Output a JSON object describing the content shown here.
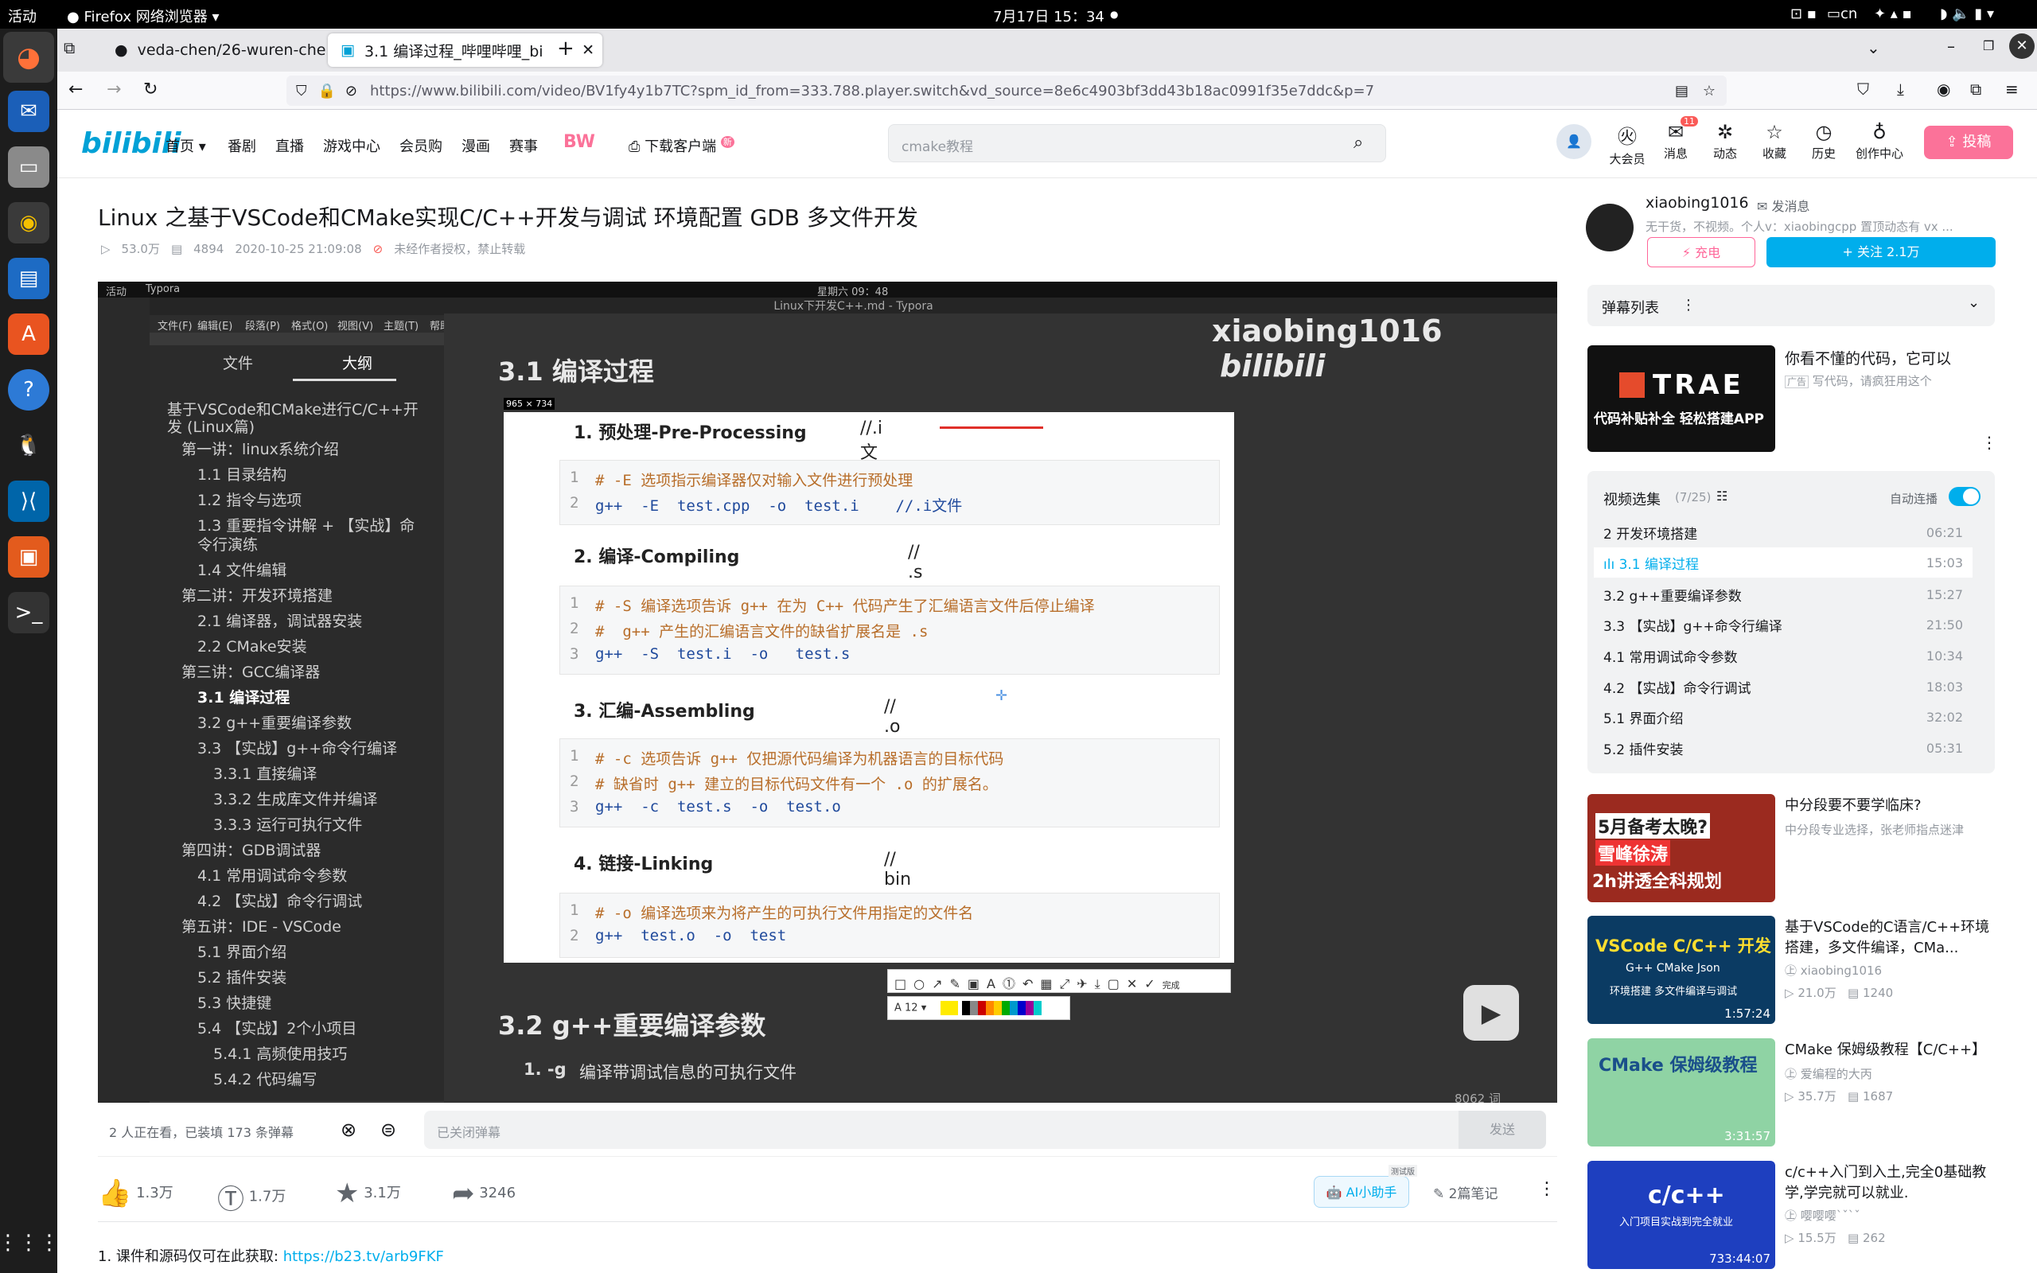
{
  "os": {
    "activities": "活动",
    "browser_label": "Firefox 网络浏览器",
    "clock": "7月17日 15：34",
    "lang": "cn"
  },
  "tabs": [
    {
      "label": "veda-chen/26-wuren-che"
    },
    {
      "label": "3.1 编译过程_哔哩哔哩_bi"
    }
  ],
  "url": "https://www.bilibili.com/video/BV1fy4y1b7TC?spm_id_from=333.788.player.switch&vd_source=8e6c4903bf3dd43b18ac0991f35e7ddc&p=7",
  "header": {
    "nav": [
      "首页",
      "番剧",
      "直播",
      "游戏中心",
      "会员购",
      "漫画",
      "赛事",
      "下载客户端"
    ],
    "bw_logo": "BW",
    "download_badge": "新",
    "search_placeholder": "cmake教程",
    "icons": [
      {
        "label": "大会员",
        "glyph": "㊋"
      },
      {
        "label": "消息",
        "glyph": "✉"
      },
      {
        "label": "动态",
        "glyph": "✲"
      },
      {
        "label": "收藏",
        "glyph": "☆"
      },
      {
        "label": "历史",
        "glyph": "◷"
      },
      {
        "label": "创作中心",
        "glyph": "💡"
      }
    ],
    "message_badge": "11",
    "upload": "投稿"
  },
  "video": {
    "title": "Linux 之基于VSCode和CMake实现C/C++开发与调试 环境配置 GDB 多文件开发",
    "views": "53.0万",
    "danmaku": "4894",
    "date": "2020-10-25 21:09:08",
    "copyright": "未经作者授权，禁止转载"
  },
  "player": {
    "watermark": "xiaobing1016",
    "watermark_logo": "bilibili",
    "sys_time": "星期六 09：48",
    "doc_title": "Linux下开发C++.md - Typora",
    "app_name": "Typora",
    "menu": [
      "文件(F)",
      "编辑(E)",
      "段落(P)",
      "格式(O)",
      "视图(V)",
      "主题(T)",
      "帮助(H)"
    ],
    "side_tabs": [
      "文件",
      "大纲"
    ],
    "outline": [
      "基于VSCode和CMake进行C/C++开",
      "发 (Linux篇)",
      "第一讲：linux系统介绍",
      "1.1 目录结构",
      "1.2 指令与选项",
      "1.3 重要指令讲解 + 【实战】命",
      "令行演练",
      "1.4 文件编辑",
      "第二讲：开发环境搭建",
      "2.1 编译器，调试器安装",
      "2.2 CMake安装",
      "第三讲：GCC编译器",
      "3.1 编译过程",
      "3.2 g++重要编译参数",
      "3.3 【实战】g++命令行编译",
      "3.3.1 直接编译",
      "3.3.2 生成库文件并编译",
      "3.3.3 运行可执行文件",
      "第四讲：GDB调试器",
      "4.1 常用调试命令参数",
      "4.2 【实战】命令行调试",
      "第五讲：IDE - VSCode",
      "5.1 界面介绍",
      "5.2 插件安装",
      "5.3 快捷键",
      "5.4 【实战】2个小项目",
      "5.4.1 高频使用技巧",
      "5.4.2 代码编写"
    ],
    "h1": "3.1 编译过程",
    "h1_next": "3.2 g++重要编译参数",
    "next_item": "1. -g",
    "next_item_desc": "编译带调试信息的可执行文件",
    "word_count": "8062 词",
    "shot_size": "965 × 734",
    "sections": [
      {
        "title": "1. 预处理-Pre-Processing",
        "note": "//.i文件",
        "lines": [
          "# -E 选项指示编译器仅对输入文件进行预处理",
          "g++  -E  test.cpp  -o  test.i    //.i文件"
        ]
      },
      {
        "title": "2. 编译-Compiling",
        "note": "// .s文件",
        "lines": [
          "# -S 编译选项告诉 g++ 在为 C++ 代码产生了汇编语言文件后停止编译",
          "#  g++ 产生的汇编语言文件的缺省扩展名是 .s",
          "g++  -S  test.i  -o   test.s"
        ]
      },
      {
        "title": "3. 汇编-Assembling",
        "note": "// .o文件",
        "lines": [
          "# -c 选项告诉 g++ 仅把源代码编译为机器语言的目标代码",
          "# 缺省时 g++ 建立的目标代码文件有一个 .o 的扩展名。",
          "g++  -c  test.s  -o  test.o"
        ]
      },
      {
        "title": "4. 链接-Linking",
        "note": "// bin文件",
        "lines": [
          "# -o 编译选项来为将产生的可执行文件用指定的文件名",
          "g++  test.o  -o  test"
        ]
      }
    ],
    "toolbar_done": "完成",
    "font_size": "12"
  },
  "danmu_bar": {
    "status": "2 人正在看，已装填 173 条弹幕",
    "input_placeholder": "已关闭弹幕",
    "send": "发送"
  },
  "actions": {
    "like": "1.3万",
    "coin": "1.7万",
    "fav": "3.1万",
    "share": "3246",
    "ai": "AI小助手",
    "ai_tag": "测试版",
    "notes": "2篇笔记"
  },
  "description": {
    "prefix": "1. 课件和源码仅可在此获取: ",
    "link": "https://b23.tv/arb9FKF"
  },
  "uploader": {
    "name": "xiaobing1016",
    "send_msg": "发消息",
    "bio": "无干货，不视频。个人v：xiaobingcpp 置顶动态有 vx ...",
    "charge": "充电",
    "follow": "关注 2.1万"
  },
  "danmaku_list": {
    "label": "弹幕列表"
  },
  "ad": {
    "brand": "TRAE",
    "caption": "代码补贴补全 轻松搭建APP",
    "title": "你看不懂的代码，它可以",
    "badge": "广告",
    "sub": "写代码，请疯狂用这个"
  },
  "playlist": {
    "title": "视频选集",
    "count": "(7/25)",
    "autoplay": "自动连播",
    "items": [
      {
        "title": "2 开发环境搭建",
        "dur": "06:21"
      },
      {
        "title": "3.1 编译过程",
        "dur": "15:03"
      },
      {
        "title": "3.2 g++重要编译参数",
        "dur": "15:27"
      },
      {
        "title": "3.3 【实战】g++命令行编译",
        "dur": "21:50"
      },
      {
        "title": "4.1 常用调试命令参数",
        "dur": "10:34"
      },
      {
        "title": "4.2 【实战】命令行调试",
        "dur": "18:03"
      },
      {
        "title": "5.1 界面介绍",
        "dur": "32:02"
      },
      {
        "title": "5.2 插件安装",
        "dur": "05:31"
      }
    ]
  },
  "recommendations": [
    {
      "title": "中分段要不要学临床?",
      "sub": "中分段专业选择，张老师指点迷津",
      "thumb_text": [
        "5月备考太晚?",
        "雪峰徐涛",
        "2h讲透全科规划"
      ],
      "duration": "",
      "views": "",
      "danmu": ""
    },
    {
      "title": "基于VSCode的C语言/C++环境搭建，多文件编译，CMa...",
      "sub": "xiaobing1016",
      "thumb_text": [
        "VSCode C/C++ 开发",
        "G++ CMake Json",
        "环境搭建 多文件编译与调试"
      ],
      "duration": "1:57:24",
      "views": "21.0万",
      "danmu": "1240"
    },
    {
      "title": "CMake 保姆级教程【C/C++】",
      "sub": "爱编程的大丙",
      "thumb_text": [
        "CMake 保姆级教程",
        "",
        ""
      ],
      "duration": "3:31:57",
      "views": "35.7万",
      "danmu": "1687"
    },
    {
      "title": "c/c++入门到入土,完全0基础教学,学完就可以就业.",
      "sub": "嘤嘤嘤`ˇ`ˇ",
      "thumb_text": [
        "c/c++",
        "入门项目实战到完全就业",
        ""
      ],
      "duration": "733:44:07",
      "views": "15.5万",
      "danmu": "262"
    }
  ],
  "colors": {
    "accent": "#00aeec",
    "pink": "#fb7299",
    "brand": "#00a1d6"
  }
}
